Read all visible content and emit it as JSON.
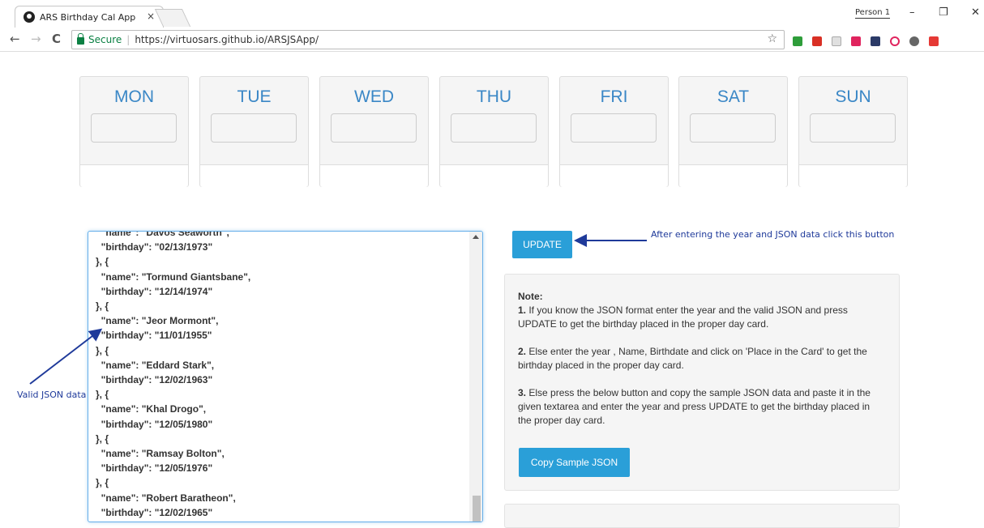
{
  "browser": {
    "tab_title": "ARS Birthday Cal App",
    "tab_close": "×",
    "profile": "Person 1",
    "min": "–",
    "restore": "❐",
    "close": "✕",
    "back": "←",
    "forward": "→",
    "reload": "C",
    "secure": "Secure",
    "separator": "|",
    "url": "https://virtuosars.github.io/ARSJSApp/",
    "star": "☆"
  },
  "days": [
    {
      "label": "MON"
    },
    {
      "label": "TUE"
    },
    {
      "label": "WED"
    },
    {
      "label": "THU"
    },
    {
      "label": "FRI"
    },
    {
      "label": "SAT"
    },
    {
      "label": "SUN"
    }
  ],
  "json_lines": [
    "  \"name\": \"Davos Seaworth\",",
    "  \"birthday\": \"02/13/1973\"",
    "}, {",
    "  \"name\": \"Tormund Giantsbane\",",
    "  \"birthday\": \"12/14/1974\"",
    "}, {",
    "  \"name\": \"Jeor Mormont\",",
    "  \"birthday\": \"11/01/1955\"",
    "}, {",
    "  \"name\": \"Eddard Stark\",",
    "  \"birthday\": \"12/02/1963\"",
    "}, {",
    "  \"name\": \"Khal Drogo\",",
    "  \"birthday\": \"12/05/1980\"",
    "}, {",
    "  \"name\": \"Ramsay Bolton\",",
    "  \"birthday\": \"12/05/1976\"",
    "}, {",
    "  \"name\": \"Robert Baratheon\",",
    "  \"birthday\": \"12/02/1965\"",
    "}, {"
  ],
  "annotations": {
    "valid_json": "Valid JSON data",
    "update_hint": "After entering the year and JSON data click this button"
  },
  "update_button": "UPDATE",
  "note": {
    "title": "Note:",
    "item1_num": "1.",
    "item1": " If you know the JSON format enter the year and the valid JSON and press UPDATE to get the birthday placed in the proper day card.",
    "item2_num": "2.",
    "item2": " Else enter the year , Name, Birthdate and click on 'Place in the Card' to get the birthday placed in the proper day card.",
    "item3_num": "3.",
    "item3": " Else press the below button and copy the sample JSON data and paste it in the given textarea and enter the year and press UPDATE to get the birthday placed in the proper day card.",
    "copy_button": "Copy Sample JSON"
  },
  "colors": {
    "accent": "#2a9fd8",
    "day_label": "#3a87c6",
    "annotation": "#1f3a9a"
  }
}
